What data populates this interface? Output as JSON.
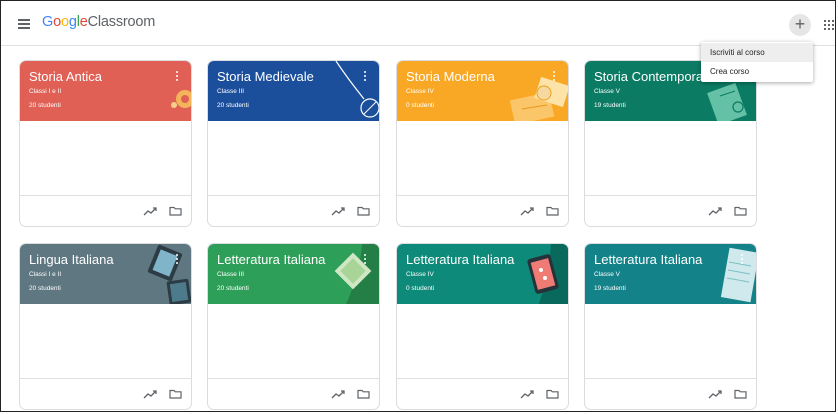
{
  "header": {
    "logo_google": [
      "G",
      "o",
      "o",
      "g",
      "l",
      "e"
    ],
    "logo_product": "Classroom",
    "plus_label": "+"
  },
  "dropdown": {
    "items": [
      "Iscriviti al corso",
      "Crea corso"
    ]
  },
  "courses": [
    {
      "title": "Storia Antica",
      "section": "Classi I e II",
      "students": "20 studenti",
      "color": "#e06055"
    },
    {
      "title": "Storia Medievale",
      "section": "Classe III",
      "students": "20 studenti",
      "color": "#1b4f9c"
    },
    {
      "title": "Storia Moderna",
      "section": "Classe IV",
      "students": "0 studenti",
      "color": "#f9a825"
    },
    {
      "title": "Storia Contemporanea",
      "section": "Classe V",
      "students": "19 studenti",
      "color": "#0c7b63"
    },
    {
      "title": "Lingua Italiana",
      "section": "Classi I e II",
      "students": "20 studenti",
      "color": "#5f7781"
    },
    {
      "title": "Letteratura Italiana",
      "section": "Classe III",
      "students": "20 studenti",
      "color": "#2e9f58"
    },
    {
      "title": "Letteratura Italiana",
      "section": "Classe IV",
      "students": "0 studenti",
      "color": "#0d8a79"
    },
    {
      "title": "Letteratura Italiana",
      "section": "Classe V",
      "students": "19 studenti",
      "color": "#138389"
    }
  ],
  "footer_icons": [
    "trending-up-icon",
    "folder-icon"
  ]
}
